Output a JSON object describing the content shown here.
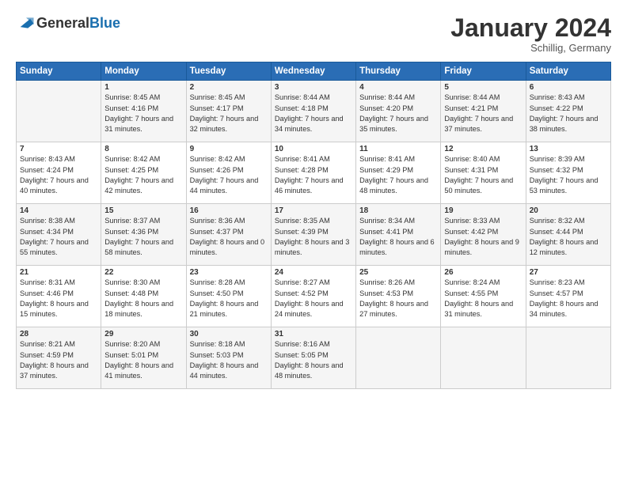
{
  "header": {
    "logo_general": "General",
    "logo_blue": "Blue",
    "title": "January 2024",
    "location": "Schillig, Germany"
  },
  "days_of_week": [
    "Sunday",
    "Monday",
    "Tuesday",
    "Wednesday",
    "Thursday",
    "Friday",
    "Saturday"
  ],
  "weeks": [
    [
      {
        "day": "",
        "sunrise": "",
        "sunset": "",
        "daylight": ""
      },
      {
        "day": "1",
        "sunrise": "Sunrise: 8:45 AM",
        "sunset": "Sunset: 4:16 PM",
        "daylight": "Daylight: 7 hours and 31 minutes."
      },
      {
        "day": "2",
        "sunrise": "Sunrise: 8:45 AM",
        "sunset": "Sunset: 4:17 PM",
        "daylight": "Daylight: 7 hours and 32 minutes."
      },
      {
        "day": "3",
        "sunrise": "Sunrise: 8:44 AM",
        "sunset": "Sunset: 4:18 PM",
        "daylight": "Daylight: 7 hours and 34 minutes."
      },
      {
        "day": "4",
        "sunrise": "Sunrise: 8:44 AM",
        "sunset": "Sunset: 4:20 PM",
        "daylight": "Daylight: 7 hours and 35 minutes."
      },
      {
        "day": "5",
        "sunrise": "Sunrise: 8:44 AM",
        "sunset": "Sunset: 4:21 PM",
        "daylight": "Daylight: 7 hours and 37 minutes."
      },
      {
        "day": "6",
        "sunrise": "Sunrise: 8:43 AM",
        "sunset": "Sunset: 4:22 PM",
        "daylight": "Daylight: 7 hours and 38 minutes."
      }
    ],
    [
      {
        "day": "7",
        "sunrise": "Sunrise: 8:43 AM",
        "sunset": "Sunset: 4:24 PM",
        "daylight": "Daylight: 7 hours and 40 minutes."
      },
      {
        "day": "8",
        "sunrise": "Sunrise: 8:42 AM",
        "sunset": "Sunset: 4:25 PM",
        "daylight": "Daylight: 7 hours and 42 minutes."
      },
      {
        "day": "9",
        "sunrise": "Sunrise: 8:42 AM",
        "sunset": "Sunset: 4:26 PM",
        "daylight": "Daylight: 7 hours and 44 minutes."
      },
      {
        "day": "10",
        "sunrise": "Sunrise: 8:41 AM",
        "sunset": "Sunset: 4:28 PM",
        "daylight": "Daylight: 7 hours and 46 minutes."
      },
      {
        "day": "11",
        "sunrise": "Sunrise: 8:41 AM",
        "sunset": "Sunset: 4:29 PM",
        "daylight": "Daylight: 7 hours and 48 minutes."
      },
      {
        "day": "12",
        "sunrise": "Sunrise: 8:40 AM",
        "sunset": "Sunset: 4:31 PM",
        "daylight": "Daylight: 7 hours and 50 minutes."
      },
      {
        "day": "13",
        "sunrise": "Sunrise: 8:39 AM",
        "sunset": "Sunset: 4:32 PM",
        "daylight": "Daylight: 7 hours and 53 minutes."
      }
    ],
    [
      {
        "day": "14",
        "sunrise": "Sunrise: 8:38 AM",
        "sunset": "Sunset: 4:34 PM",
        "daylight": "Daylight: 7 hours and 55 minutes."
      },
      {
        "day": "15",
        "sunrise": "Sunrise: 8:37 AM",
        "sunset": "Sunset: 4:36 PM",
        "daylight": "Daylight: 7 hours and 58 minutes."
      },
      {
        "day": "16",
        "sunrise": "Sunrise: 8:36 AM",
        "sunset": "Sunset: 4:37 PM",
        "daylight": "Daylight: 8 hours and 0 minutes."
      },
      {
        "day": "17",
        "sunrise": "Sunrise: 8:35 AM",
        "sunset": "Sunset: 4:39 PM",
        "daylight": "Daylight: 8 hours and 3 minutes."
      },
      {
        "day": "18",
        "sunrise": "Sunrise: 8:34 AM",
        "sunset": "Sunset: 4:41 PM",
        "daylight": "Daylight: 8 hours and 6 minutes."
      },
      {
        "day": "19",
        "sunrise": "Sunrise: 8:33 AM",
        "sunset": "Sunset: 4:42 PM",
        "daylight": "Daylight: 8 hours and 9 minutes."
      },
      {
        "day": "20",
        "sunrise": "Sunrise: 8:32 AM",
        "sunset": "Sunset: 4:44 PM",
        "daylight": "Daylight: 8 hours and 12 minutes."
      }
    ],
    [
      {
        "day": "21",
        "sunrise": "Sunrise: 8:31 AM",
        "sunset": "Sunset: 4:46 PM",
        "daylight": "Daylight: 8 hours and 15 minutes."
      },
      {
        "day": "22",
        "sunrise": "Sunrise: 8:30 AM",
        "sunset": "Sunset: 4:48 PM",
        "daylight": "Daylight: 8 hours and 18 minutes."
      },
      {
        "day": "23",
        "sunrise": "Sunrise: 8:28 AM",
        "sunset": "Sunset: 4:50 PM",
        "daylight": "Daylight: 8 hours and 21 minutes."
      },
      {
        "day": "24",
        "sunrise": "Sunrise: 8:27 AM",
        "sunset": "Sunset: 4:52 PM",
        "daylight": "Daylight: 8 hours and 24 minutes."
      },
      {
        "day": "25",
        "sunrise": "Sunrise: 8:26 AM",
        "sunset": "Sunset: 4:53 PM",
        "daylight": "Daylight: 8 hours and 27 minutes."
      },
      {
        "day": "26",
        "sunrise": "Sunrise: 8:24 AM",
        "sunset": "Sunset: 4:55 PM",
        "daylight": "Daylight: 8 hours and 31 minutes."
      },
      {
        "day": "27",
        "sunrise": "Sunrise: 8:23 AM",
        "sunset": "Sunset: 4:57 PM",
        "daylight": "Daylight: 8 hours and 34 minutes."
      }
    ],
    [
      {
        "day": "28",
        "sunrise": "Sunrise: 8:21 AM",
        "sunset": "Sunset: 4:59 PM",
        "daylight": "Daylight: 8 hours and 37 minutes."
      },
      {
        "day": "29",
        "sunrise": "Sunrise: 8:20 AM",
        "sunset": "Sunset: 5:01 PM",
        "daylight": "Daylight: 8 hours and 41 minutes."
      },
      {
        "day": "30",
        "sunrise": "Sunrise: 8:18 AM",
        "sunset": "Sunset: 5:03 PM",
        "daylight": "Daylight: 8 hours and 44 minutes."
      },
      {
        "day": "31",
        "sunrise": "Sunrise: 8:16 AM",
        "sunset": "Sunset: 5:05 PM",
        "daylight": "Daylight: 8 hours and 48 minutes."
      },
      {
        "day": "",
        "sunrise": "",
        "sunset": "",
        "daylight": ""
      },
      {
        "day": "",
        "sunrise": "",
        "sunset": "",
        "daylight": ""
      },
      {
        "day": "",
        "sunrise": "",
        "sunset": "",
        "daylight": ""
      }
    ]
  ]
}
